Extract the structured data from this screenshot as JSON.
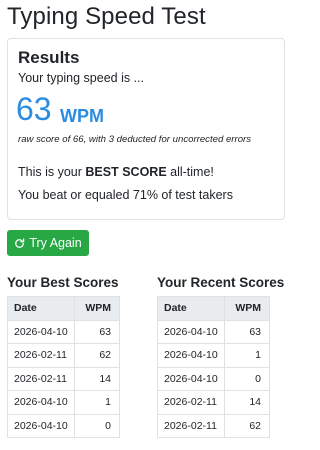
{
  "page": {
    "title": "Typing Speed Test"
  },
  "results": {
    "title": "Results",
    "intro": "Your typing speed is ...",
    "wpm": "63",
    "unit": "WPM",
    "raw_note": "raw score of 66, with 3 deducted for uncorrected errors",
    "best_prefix": "This is your ",
    "best_strong": "BEST SCORE",
    "best_suffix": " all-time!",
    "beat_text": "You beat or equaled 71% of test takers"
  },
  "actions": {
    "try_again_label": "Try Again",
    "try_again_icon": "refresh-icon",
    "try_again_color": "#28a745"
  },
  "accent_color": "#2b8de0",
  "best_scores": {
    "title": "Your Best Scores",
    "columns": [
      "Date",
      "WPM"
    ],
    "rows": [
      [
        "2026-04-10",
        "63"
      ],
      [
        "2026-02-11",
        "62"
      ],
      [
        "2026-02-11",
        "14"
      ],
      [
        "2026-04-10",
        "1"
      ],
      [
        "2026-04-10",
        "0"
      ]
    ]
  },
  "recent_scores": {
    "title": "Your Recent Scores",
    "columns": [
      "Date",
      "WPM"
    ],
    "rows": [
      [
        "2026-04-10",
        "63"
      ],
      [
        "2026-04-10",
        "1"
      ],
      [
        "2026-04-10",
        "0"
      ],
      [
        "2026-02-11",
        "14"
      ],
      [
        "2026-02-11",
        "62"
      ]
    ]
  }
}
